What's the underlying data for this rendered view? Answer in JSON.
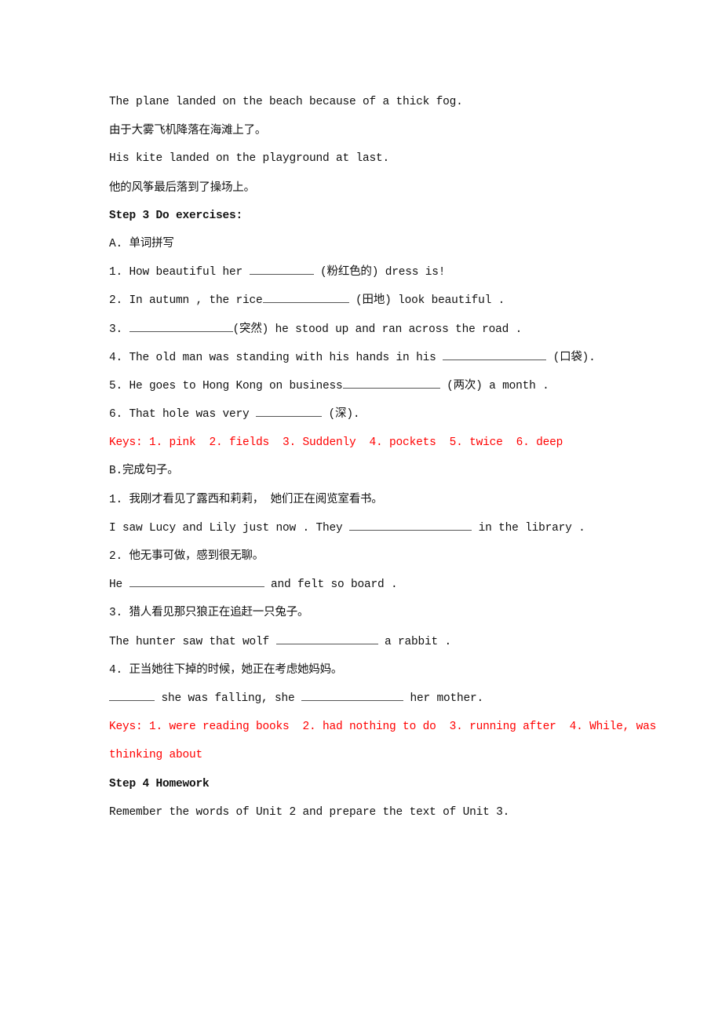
{
  "intro": {
    "line1": "The plane landed on the beach because of a thick fog.",
    "line2": "由于大雾飞机降落在海滩上了。",
    "line3": "His kite landed on the playground at last.",
    "line4": "他的风筝最后落到了操场上。"
  },
  "step3": {
    "heading": "Step 3 Do exercises:",
    "partA": {
      "title": "A. 单词拼写",
      "items": [
        {
          "pre": "1. How beautiful her ",
          "post": " (粉红色的) dress is!"
        },
        {
          "pre": "2. In autumn , the rice",
          "post": " (田地) look beautiful ."
        },
        {
          "pre": "3. ",
          "post": "(突然) he stood up and ran across the road ."
        },
        {
          "pre": "4. The old man was standing with his hands in his ",
          "post": " (口袋)."
        },
        {
          "pre": "5. He goes to Hong Kong on business",
          "post": " (两次) a month ."
        },
        {
          "pre": "6. That hole was very ",
          "post": " (深)."
        }
      ],
      "keys": "Keys: 1. pink  2. fields  3. Suddenly  4. pockets  5. twice  6. deep"
    },
    "partB": {
      "title": "B.完成句子。",
      "items": [
        {
          "cn": "1. 我刚才看见了露西和莉莉， 她们正在阅览室看书。",
          "pre": "I saw Lucy and Lily just now . They ",
          "post": " in the library ."
        },
        {
          "cn": "2. 他无事可做，感到很无聊。",
          "pre": "He ",
          "post": " and felt so board ."
        },
        {
          "cn": "3. 猎人看见那只狼正在追赶一只兔子。",
          "pre": "The hunter saw that wolf ",
          "post": " a rabbit ."
        },
        {
          "cn": "4. 正当她往下掉的时候，她正在考虑她妈妈。",
          "pre": "",
          "mid": " she was falling, she ",
          "post": " her mother."
        }
      ],
      "keys_line1": "Keys: 1. were reading books  2. had nothing to do  3. running after  4. While, was",
      "keys_line2": "thinking about"
    }
  },
  "step4": {
    "heading": "Step 4 Homework",
    "text": "Remember the words of Unit 2 and prepare the text of Unit 3."
  },
  "colors": {
    "text": "#111111",
    "keys": "#ff0000"
  }
}
